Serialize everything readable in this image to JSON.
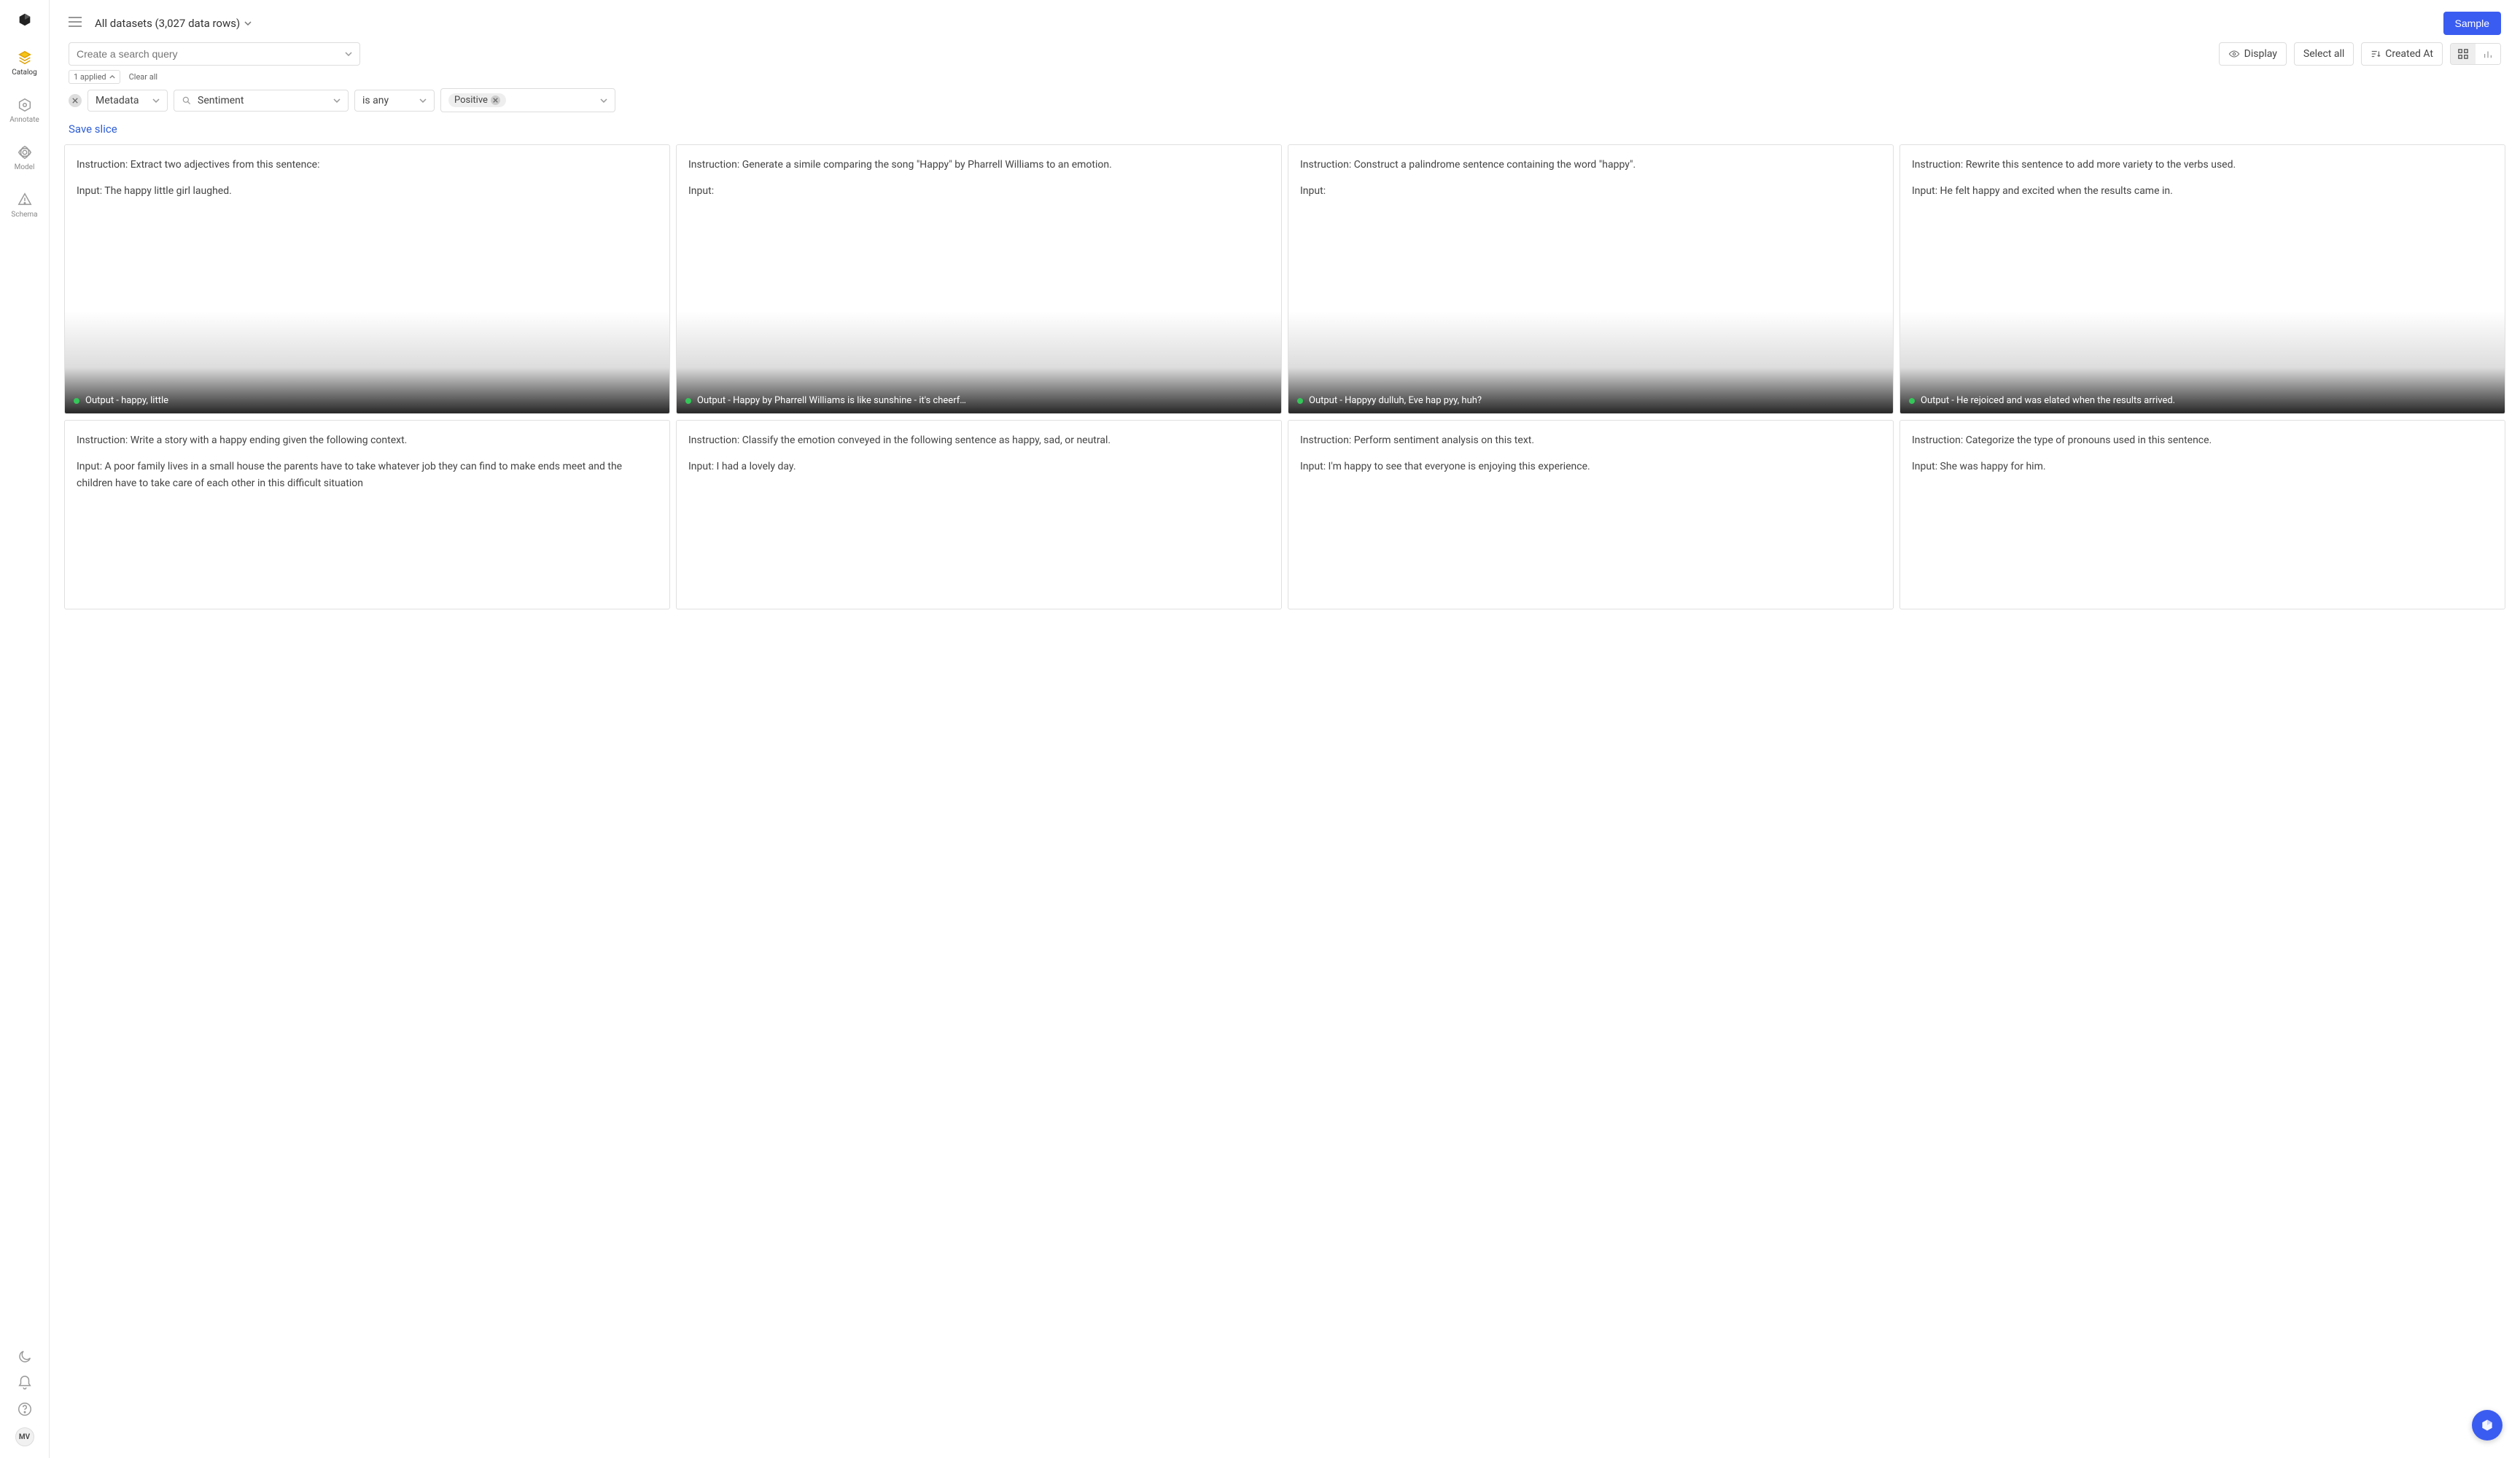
{
  "sidebar": {
    "items": [
      {
        "label": "Catalog"
      },
      {
        "label": "Annotate"
      },
      {
        "label": "Model"
      },
      {
        "label": "Schema"
      }
    ],
    "avatar": "MV"
  },
  "header": {
    "dataset_label": "All datasets (3,027 data rows)",
    "sample_label": "Sample"
  },
  "toolbar": {
    "search_placeholder": "Create a search query",
    "display_label": "Display",
    "select_all_label": "Select all",
    "sort_label": "Created At"
  },
  "filter_meta": {
    "applied_label": "1 applied",
    "clear_label": "Clear all"
  },
  "filter": {
    "field_type": "Metadata",
    "field_name": "Sentiment",
    "operator": "is any",
    "value": "Positive"
  },
  "save_slice_label": "Save slice",
  "cards": [
    {
      "instruction": "Instruction: Extract two adjectives from this sentence:",
      "input": "Input: The happy little girl laughed.",
      "output": "Output - happy, little"
    },
    {
      "instruction": "Instruction: Generate a simile comparing the song \"Happy\" by Pharrell Williams to an emotion.",
      "input": "Input:",
      "output": "Output - Happy by Pharrell Williams is like sunshine - it's cheerf…"
    },
    {
      "instruction": "Instruction: Construct a palindrome sentence containing the word \"happy\".",
      "input": "Input:",
      "output": "Output - Happyy dulluh, Eve hap pyy, huh?"
    },
    {
      "instruction": "Instruction: Rewrite this sentence to add more variety to the verbs used.",
      "input": "Input: He felt happy and excited when the results came in.",
      "output": "Output - He rejoiced and was elated when the results arrived."
    },
    {
      "instruction": "Instruction: Write a story with a happy ending given the following context.",
      "input": "Input: A poor family lives in a small house the parents have to take whatever job they can find to make ends meet and the children have to take care of each other in this difficult situation",
      "output": ""
    },
    {
      "instruction": "Instruction: Classify the emotion conveyed in the following sentence as happy, sad, or neutral.",
      "input": "Input: I had a lovely day.",
      "output": ""
    },
    {
      "instruction": "Instruction: Perform sentiment analysis on this text.",
      "input": "Input: I'm happy to see that everyone is enjoying this experience.",
      "output": ""
    },
    {
      "instruction": "Instruction: Categorize the type of pronouns used in this sentence.",
      "input": "Input: She was happy for him.",
      "output": ""
    }
  ]
}
